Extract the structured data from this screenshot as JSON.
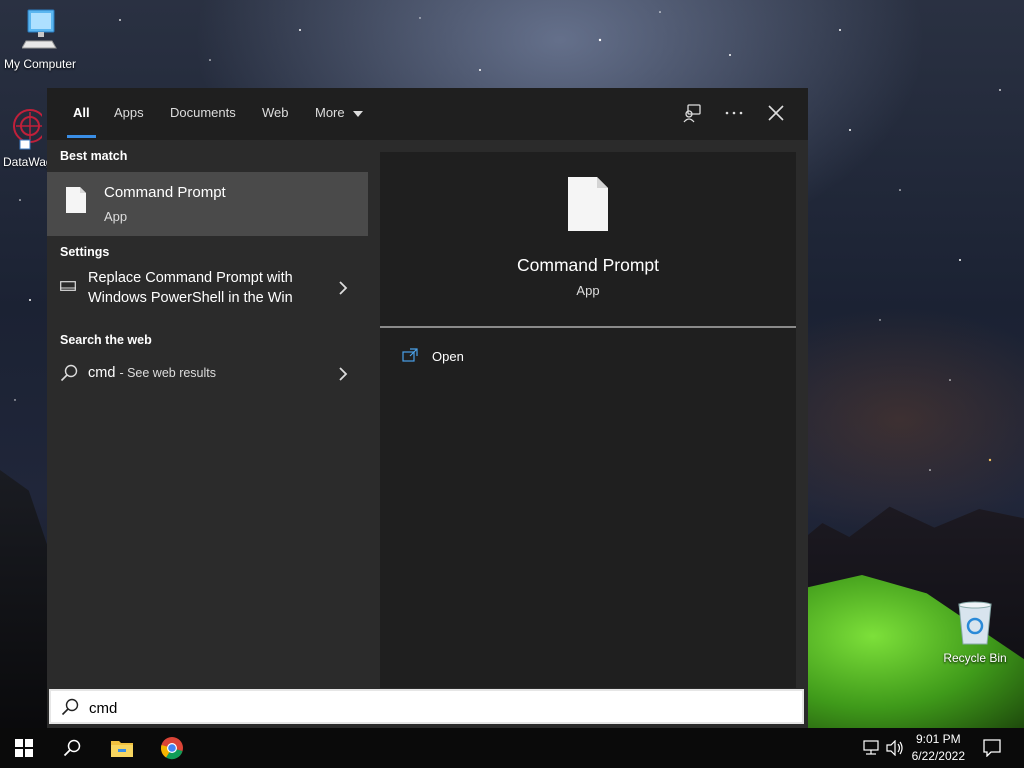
{
  "desktop": {
    "icons": [
      {
        "label": "My Computer"
      },
      {
        "label": "DataWag"
      },
      {
        "label": "Recycle Bin"
      }
    ]
  },
  "search_panel": {
    "tabs": [
      {
        "label": "All",
        "active": true
      },
      {
        "label": "Apps"
      },
      {
        "label": "Documents"
      },
      {
        "label": "Web"
      },
      {
        "label": "More"
      }
    ],
    "best_match_title": "Best match",
    "best_match": {
      "name": "Command Prompt",
      "type": "App"
    },
    "settings_title": "Settings",
    "settings_item": {
      "line1": "Replace Command Prompt with",
      "line2": "Windows PowerShell in the Win"
    },
    "web_title": "Search the web",
    "web_item": {
      "query": "cmd",
      "suffix": "- See web results"
    },
    "preview": {
      "name": "Command Prompt",
      "type": "App",
      "action_open": "Open"
    },
    "search_input": {
      "value": "cmd",
      "placeholder": ""
    }
  },
  "taskbar": {
    "time": "9:01 PM",
    "date": "6/22/2022"
  },
  "colors": {
    "accent": "#3a8ee6",
    "panel_bg": "#2b2b2b",
    "selected_bg": "#4a4a4a"
  }
}
